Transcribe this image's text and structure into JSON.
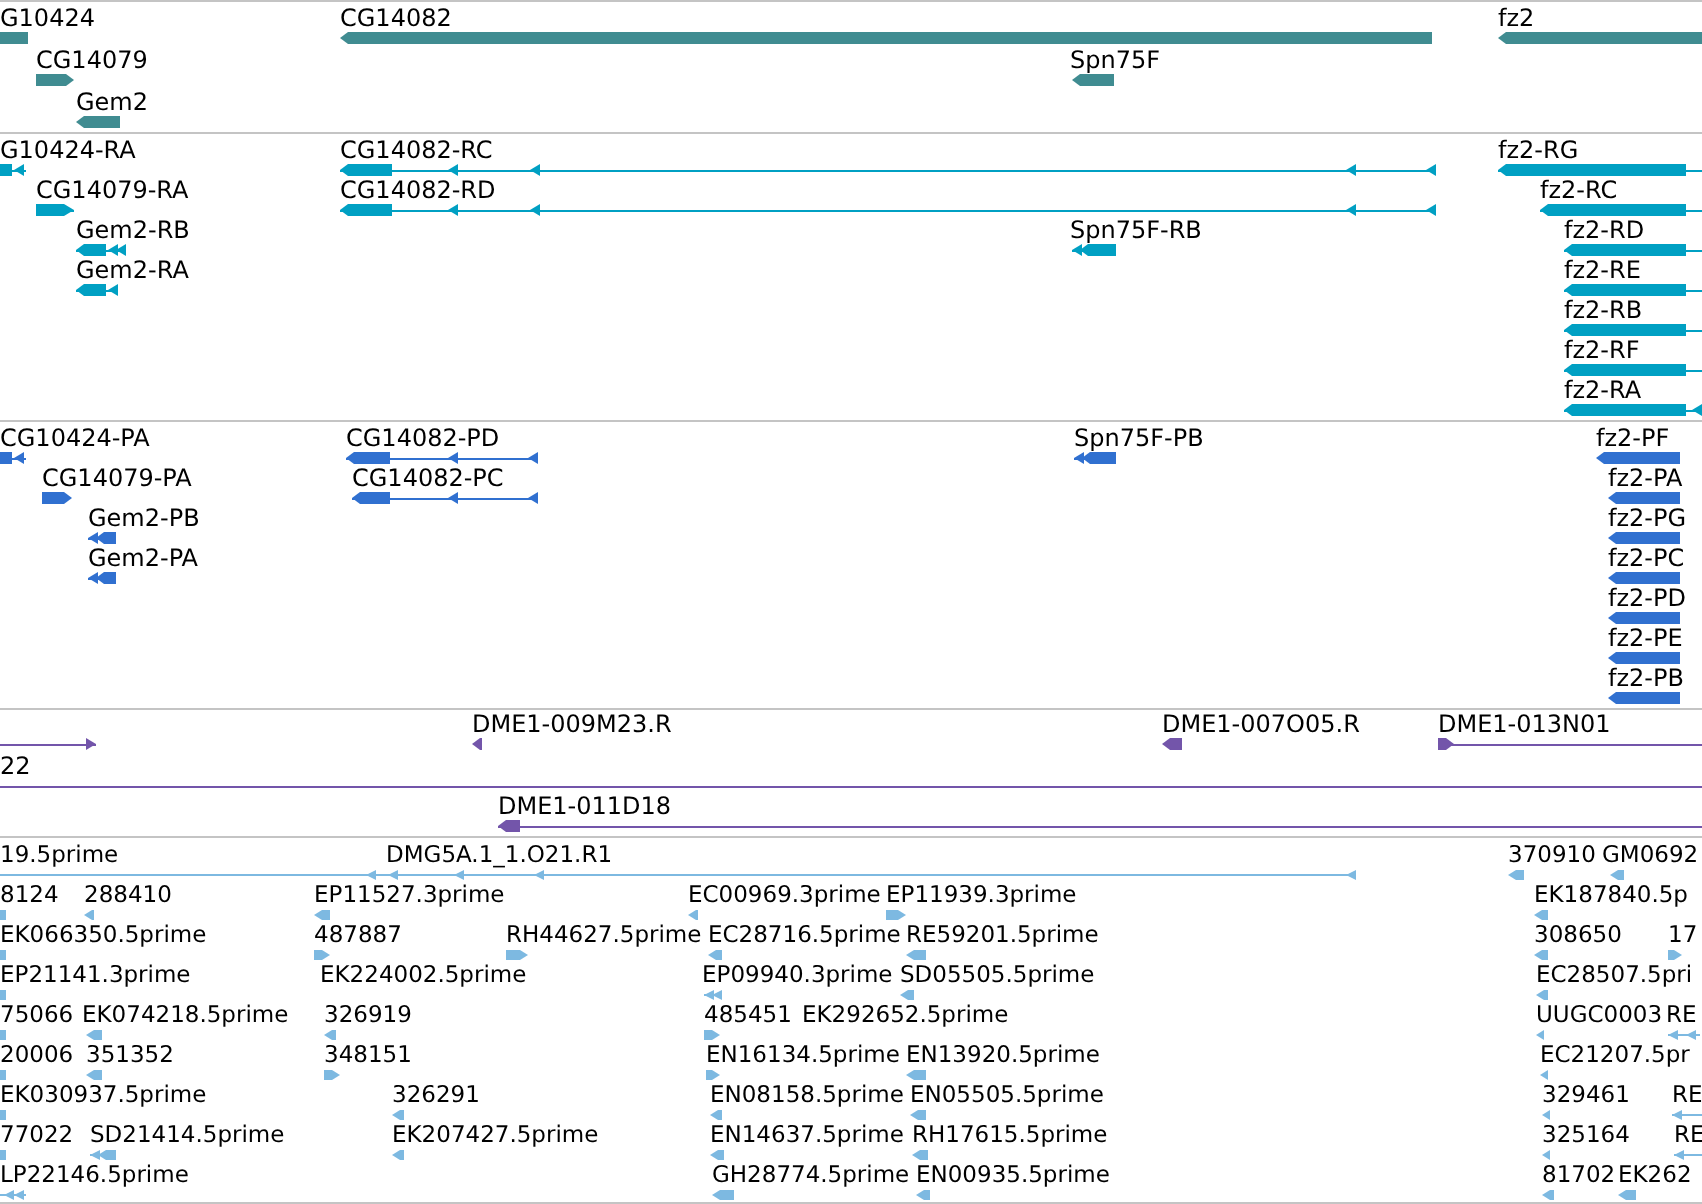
{
  "tracks": [
    {
      "color": "#408c91",
      "features": [
        {
          "label": "G10424"
        },
        {
          "label": "CG14079",
          "reverse": false
        },
        {
          "label": "Gem2",
          "reverse": true
        },
        {
          "label": "CG14082",
          "reverse": true
        },
        {
          "label": "Spn75F",
          "reverse": true
        },
        {
          "label": "fz2",
          "reverse": true
        }
      ]
    },
    {
      "color": "#00a0c3",
      "features": [
        {
          "label": "G10424-RA",
          "reverse": true
        },
        {
          "label": "CG14079-RA",
          "reverse": false
        },
        {
          "label": "Gem2-RB",
          "reverse": true
        },
        {
          "label": "Gem2-RA",
          "reverse": true
        },
        {
          "label": "CG14082-RC",
          "reverse": true
        },
        {
          "label": "CG14082-RD",
          "reverse": true
        },
        {
          "label": "Spn75F-RB",
          "reverse": true
        },
        {
          "label": "fz2-RG",
          "reverse": true
        },
        {
          "label": "fz2-RC",
          "reverse": true
        },
        {
          "label": "fz2-RD",
          "reverse": true
        },
        {
          "label": "fz2-RE",
          "reverse": true
        },
        {
          "label": "fz2-RB",
          "reverse": true
        },
        {
          "label": "fz2-RF",
          "reverse": true
        },
        {
          "label": "fz2-RA",
          "reverse": true
        }
      ]
    },
    {
      "color": "#3070d0",
      "features": [
        {
          "label": "CG10424-PA",
          "reverse": true
        },
        {
          "label": "CG14079-PA",
          "reverse": false
        },
        {
          "label": "Gem2-PB",
          "reverse": true
        },
        {
          "label": "Gem2-PA",
          "reverse": true
        },
        {
          "label": "CG14082-PD",
          "reverse": true
        },
        {
          "label": "CG14082-PC",
          "reverse": true
        },
        {
          "label": "Spn75F-PB",
          "reverse": true
        },
        {
          "label": "fz2-PF",
          "reverse": true
        },
        {
          "label": "fz2-PA",
          "reverse": true
        },
        {
          "label": "fz2-PG",
          "reverse": true
        },
        {
          "label": "fz2-PC",
          "reverse": true
        },
        {
          "label": "fz2-PD",
          "reverse": true
        },
        {
          "label": "fz2-PE",
          "reverse": true
        },
        {
          "label": "fz2-PB",
          "reverse": true
        }
      ]
    },
    {
      "color": "#7355aa",
      "features": [
        {
          "reverse": false
        },
        {
          "label": "DME1-009M23.R",
          "reverse": true
        },
        {
          "label": "DME1-007O05.R",
          "reverse": true
        },
        {
          "label": "DME1-013N01",
          "reverse": false
        },
        {
          "label": "22"
        },
        {
          "label": "DME1-011D18",
          "reverse": true
        }
      ]
    },
    {
      "color": "#7db9e1",
      "features": [
        {
          "label": "19.5prime",
          "reverse": true
        },
        {
          "label": "DMG5A.1_1.O21.R1",
          "reverse": true
        },
        {
          "label": "370910",
          "reverse": true
        },
        {
          "label": "GM0692",
          "reverse": true
        },
        {
          "label": "8124"
        },
        {
          "label": "288410",
          "reverse": true
        },
        {
          "label": "EP11527.3prime",
          "reverse": true
        },
        {
          "label": "EC00969.3prime",
          "reverse": true
        },
        {
          "label": "EP11939.3prime",
          "reverse": false
        },
        {
          "label": "EK187840.5p",
          "reverse": true
        },
        {
          "label": "EK066350.5prime"
        },
        {
          "label": "487887",
          "reverse": false
        },
        {
          "label": "RH44627.5prime",
          "reverse": false
        },
        {
          "label": "EC28716.5prime",
          "reverse": true
        },
        {
          "label": "RE59201.5prime",
          "reverse": true
        },
        {
          "label": "308650",
          "reverse": true
        },
        {
          "label": "17",
          "reverse": false
        },
        {
          "label": "EP21141.3prime"
        },
        {
          "label": "EK224002.5prime"
        },
        {
          "label": "EP09940.3prime",
          "reverse": true
        },
        {
          "label": "SD05505.5prime",
          "reverse": true
        },
        {
          "label": "EC28507.5pri",
          "reverse": true
        },
        {
          "label": "75066"
        },
        {
          "label": "EK074218.5prime",
          "reverse": true
        },
        {
          "label": "326919",
          "reverse": true
        },
        {
          "label": "485451",
          "reverse": false
        },
        {
          "label": "EK292652.5prime"
        },
        {
          "label": "UUGC0003",
          "reverse": true
        },
        {
          "label": "RE",
          "reverse": true
        },
        {
          "label": "20006"
        },
        {
          "label": "351352",
          "reverse": true
        },
        {
          "label": "348151",
          "reverse": false
        },
        {
          "label": "EN16134.5prime",
          "reverse": false
        },
        {
          "label": "EN13920.5prime",
          "reverse": true
        },
        {
          "label": "EC21207.5pr",
          "reverse": true
        },
        {
          "label": "EK030937.5prime"
        },
        {
          "label": "326291",
          "reverse": true
        },
        {
          "label": "EN08158.5prime",
          "reverse": true
        },
        {
          "label": "EN05505.5prime",
          "reverse": true
        },
        {
          "label": "329461",
          "reverse": true
        },
        {
          "label": "RE",
          "reverse": true
        },
        {
          "label": "77022"
        },
        {
          "label": "SD21414.5prime",
          "reverse": true
        },
        {
          "label": "EK207427.5prime",
          "reverse": true
        },
        {
          "label": "EN14637.5prime",
          "reverse": true
        },
        {
          "label": "RH17615.5prime",
          "reverse": true
        },
        {
          "label": "325164",
          "reverse": true
        },
        {
          "label": "RE",
          "reverse": true
        },
        {
          "label": "LP22146.5prime",
          "reverse": true
        },
        {
          "label": "GH28774.5prime",
          "reverse": true
        },
        {
          "label": "EN00935.5prime",
          "reverse": true
        },
        {
          "label": "81702",
          "reverse": true
        },
        {
          "label": "EK262",
          "reverse": true
        }
      ]
    }
  ]
}
